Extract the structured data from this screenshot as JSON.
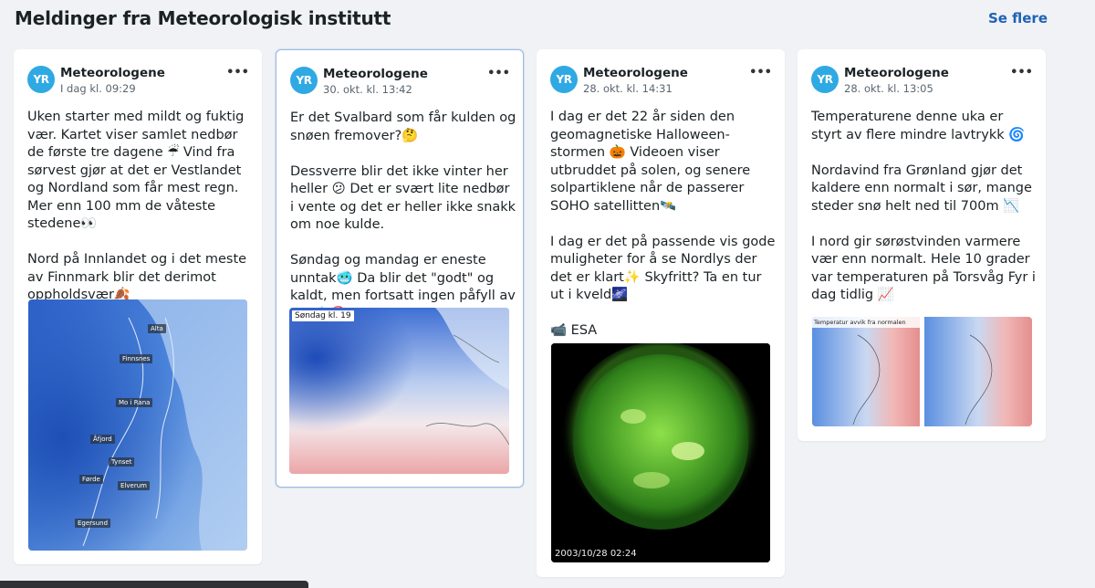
{
  "section": {
    "title": "Meldinger fra Meteorologisk institutt",
    "see_more": "Se flere"
  },
  "logo_text": "YR",
  "cards": [
    {
      "author": "Meteorologene",
      "time": "I dag kl. 09:29",
      "more": "•••",
      "paragraphs": [
        "Uken starter med mildt og fuktig vær. Kartet viser samlet nedbør de første tre dagene ☔ Vind fra sørvest gjør at det er Vestlandet og Nordland som får mest regn. Mer enn 100 mm de våteste stedene👀",
        "Nord på Innlandet og i det meste av Finnmark blir det derimot oppholdsvær🍂"
      ],
      "map_labels": [
        "Alta",
        "Finnsnes",
        "Mo i Rana",
        "Åfjord",
        "Tynset",
        "Førde",
        "Elverum",
        "Egersund"
      ]
    },
    {
      "author": "Meteorologene",
      "time": "30. okt. kl. 13:42",
      "more": "•••",
      "paragraphs": [
        "Er det Svalbard som får kulden og snøen fremover?🤔",
        "Dessverre blir det ikke vinter her heller 😕 Det er svært lite nedbør i vente og det er heller ikke snakk om noe kulde.",
        "Søndag og mandag er eneste unntak🥶 Da blir det \"godt\" og kaldt, men fortsatt ingen påfyll av snø❄️🚫"
      ],
      "map_caption": "Søndag kl. 19"
    },
    {
      "author": "Meteorologene",
      "time": "28. okt. kl. 14:31",
      "more": "•••",
      "paragraphs": [
        "I dag er det 22 år siden den geomagnetiske Halloween-stormen 🎃 Videoen viser utbruddet på solen, og senere solpartiklene når de passerer SOHO satellitten🛰️",
        "I dag er det på passende vis gode muligheter for å se Nordlys der det er klart✨ Skyfritt? Ta en tur ut i kveld🌌",
        "📹 ESA"
      ],
      "image_caption": "2003/10/28 02:24"
    },
    {
      "author": "Meteorologene",
      "time": "28. okt. kl. 13:05",
      "more": "•••",
      "paragraphs": [
        "Temperaturene denne uka er styrt av flere mindre lavtrykk 🌀",
        "Nordavind fra Grønland gjør det kaldere enn normalt i sør, mange steder snø helt ned til 700m 📉",
        "I nord gir sørøstvinden varmere vær enn normalt. Hele 10 grader var temperaturen på Torsvåg Fyr i dag tidlig 📈"
      ],
      "map_caption": "Temperatur avvik fra normalen"
    }
  ],
  "colors": {
    "link": "#1f62b5",
    "logo": "#2fa9e4",
    "background": "#f0f2f5",
    "selected_border": "#9dbbe4"
  }
}
